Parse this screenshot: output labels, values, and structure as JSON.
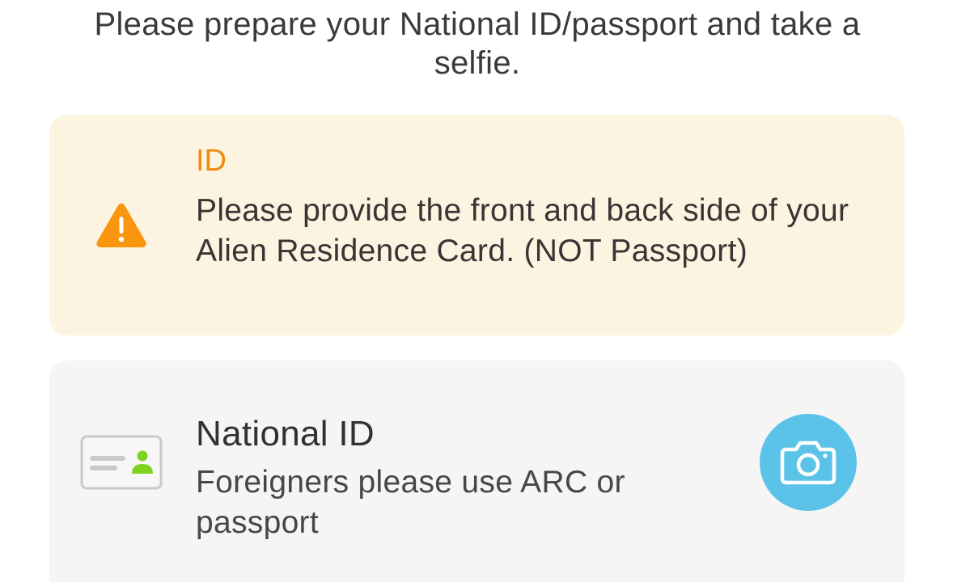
{
  "header": {
    "instructions": "Please prepare your National ID/passport and take a selfie."
  },
  "notice": {
    "icon": "warning-icon",
    "title": "ID",
    "body": "Please provide the front and back side of your Alien Residence Card.  (NOT Passport)",
    "background_color": "#fdf3e1",
    "title_color": "#ef8b0e",
    "icon_color": "#f9950f"
  },
  "document_option": {
    "icon": "id-card-icon",
    "title": "National ID",
    "subtitle": "Foreigners please use ARC or passport",
    "action_icon": "camera-icon",
    "action_color": "#5bc3e8",
    "card_background": "#f5f5f5",
    "id_icon_accent": "#7ed321"
  }
}
